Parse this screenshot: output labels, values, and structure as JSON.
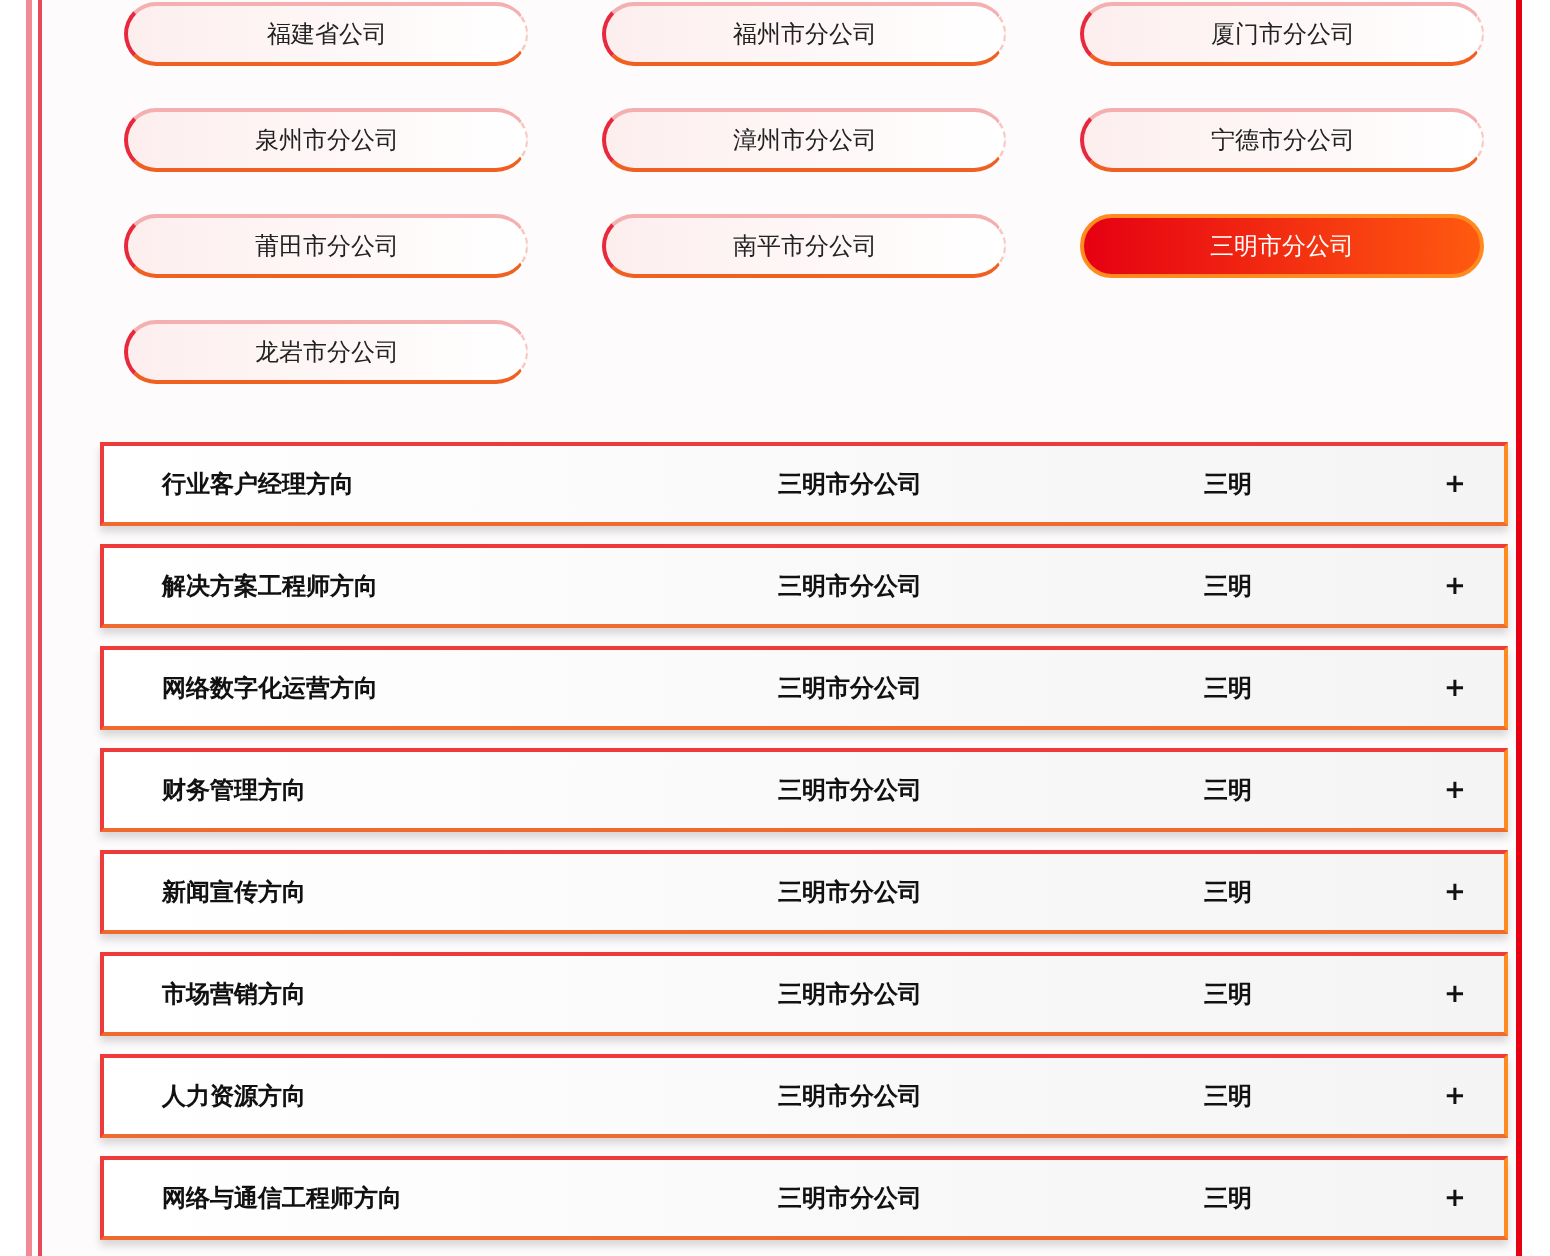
{
  "branches": [
    {
      "label": "福建省公司",
      "selected": false
    },
    {
      "label": "福州市分公司",
      "selected": false
    },
    {
      "label": "厦门市分公司",
      "selected": false
    },
    {
      "label": "泉州市分公司",
      "selected": false
    },
    {
      "label": "漳州市分公司",
      "selected": false
    },
    {
      "label": "宁德市分公司",
      "selected": false
    },
    {
      "label": "莆田市分公司",
      "selected": false
    },
    {
      "label": "南平市分公司",
      "selected": false
    },
    {
      "label": "三明市分公司",
      "selected": true
    },
    {
      "label": "龙岩市分公司",
      "selected": false
    }
  ],
  "positions": [
    {
      "title": "行业客户经理方向",
      "branch": "三明市分公司",
      "city": "三明",
      "toggle": "+"
    },
    {
      "title": "解决方案工程师方向",
      "branch": "三明市分公司",
      "city": "三明",
      "toggle": "+"
    },
    {
      "title": "网络数字化运营方向",
      "branch": "三明市分公司",
      "city": "三明",
      "toggle": "+"
    },
    {
      "title": "财务管理方向",
      "branch": "三明市分公司",
      "city": "三明",
      "toggle": "+"
    },
    {
      "title": "新闻宣传方向",
      "branch": "三明市分公司",
      "city": "三明",
      "toggle": "+"
    },
    {
      "title": "市场营销方向",
      "branch": "三明市分公司",
      "city": "三明",
      "toggle": "+"
    },
    {
      "title": "人力资源方向",
      "branch": "三明市分公司",
      "city": "三明",
      "toggle": "+"
    },
    {
      "title": "网络与通信工程师方向",
      "branch": "三明市分公司",
      "city": "三明",
      "toggle": "+"
    }
  ]
}
